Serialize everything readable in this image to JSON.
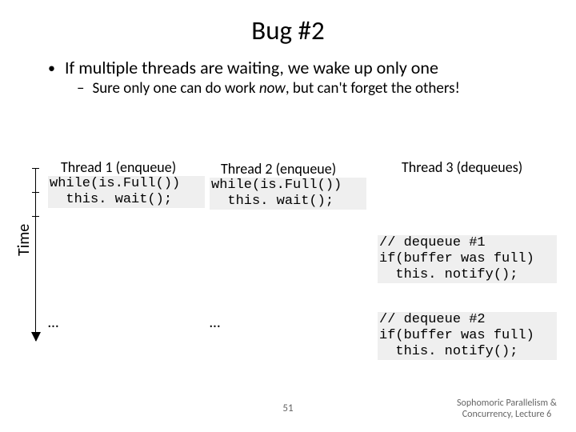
{
  "title": "Bug #2",
  "bullet1": "If multiple threads are waiting, we wake up only one",
  "bullet2_pre": "Sure only one can do work ",
  "bullet2_now": "now",
  "bullet2_post": ", but can't forget the others!",
  "time_label": "Time",
  "col1": {
    "head": "Thread 1 (enqueue)",
    "code": "while(is.Full())\n  this. wait();",
    "dots": "…"
  },
  "col2": {
    "head": "Thread 2 (enqueue)",
    "code": "while(is.Full())\n  this. wait();",
    "dots": "…"
  },
  "col3": {
    "head": "Thread 3 (dequeues)",
    "code1": "// dequeue #1\nif(buffer was full)\n  this. notify();",
    "code2": "// dequeue #2\nif(buffer was full)\n  this. notify();"
  },
  "page_number": "51",
  "footer_l1": "Sophomoric Parallelism &",
  "footer_l2": "Concurrency, Lecture 6"
}
